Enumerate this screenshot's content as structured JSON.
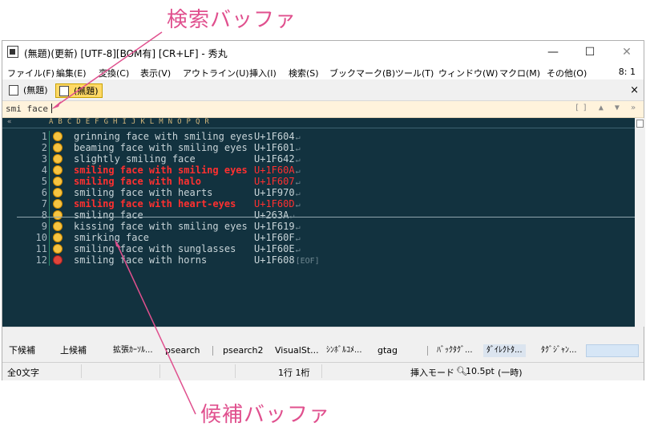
{
  "annotations": {
    "search_buffer": "検索バッファ",
    "candidate_buffer": "候補バッファ",
    "color": "#e0508e"
  },
  "window": {
    "title": "(無題)(更新) [UTF-8][BOM有] [CR+LF] - 秀丸",
    "minimize": "—",
    "maximize": "☐",
    "close": "✕"
  },
  "menu": {
    "items": [
      "ファイル(F)",
      "編集(E)",
      "変換(C)",
      "表示(V)",
      "アウトライン(U)",
      "挿入(I)",
      "検索(S)",
      "ブックマーク(B)",
      "ツール(T)",
      "ウィンドウ(W)",
      "マクロ(M)",
      "その他(O)"
    ],
    "position": "8: 1"
  },
  "tabs": [
    {
      "label": "(無題)",
      "active": false
    },
    {
      "label": "(無題)",
      "active": true
    }
  ],
  "tab_close": "×",
  "search": {
    "value": "smi face",
    "controls": "[] ▲ ▼ »"
  },
  "ruler": "A     B                          C     D     E     F     G     H     I     J     K     L     M     N     O     P     Q     R",
  "ruler_mark": "«",
  "lines": [
    {
      "num": "1",
      "name": "grinning face with smiling eyes",
      "code": "U+1F604",
      "hit": false,
      "emoji": "yellow"
    },
    {
      "num": "2",
      "name": "beaming face with smiling eyes",
      "code": "U+1F601",
      "hit": false,
      "emoji": "yellow"
    },
    {
      "num": "3",
      "name": "slightly smiling face",
      "code": "U+1F642",
      "hit": false,
      "emoji": "yellow"
    },
    {
      "num": "4",
      "name": "smiling face with smiling eyes",
      "code": "U+1F60A",
      "hit": true,
      "emoji": "yellow"
    },
    {
      "num": "5",
      "name": "smiling face with halo",
      "code": "U+1F607",
      "hit": true,
      "emoji": "yellow"
    },
    {
      "num": "6",
      "name": "smiling face with hearts",
      "code": "U+1F970",
      "hit": false,
      "emoji": "yellow"
    },
    {
      "num": "7",
      "name": "smiling face with heart-eyes",
      "code": "U+1F60D",
      "hit": true,
      "emoji": "yellow"
    },
    {
      "num": "8",
      "name": "smiling face",
      "code": "U+263A",
      "hit": false,
      "emoji": "yellow"
    },
    {
      "num": "9",
      "name": "kissing face with smiling eyes",
      "code": "U+1F619",
      "hit": false,
      "emoji": "yellow"
    },
    {
      "num": "10",
      "name": "smirking face",
      "code": "U+1F60F",
      "hit": false,
      "emoji": "yellow"
    },
    {
      "num": "11",
      "name": "smiling face with sunglasses",
      "code": "U+1F60E",
      "hit": false,
      "emoji": "yellow"
    },
    {
      "num": "12",
      "name": "smiling face with horns",
      "code": "U+1F608",
      "hit": false,
      "emoji": "red",
      "eof": "[EOF]"
    }
  ],
  "eol_mark": "↵",
  "funcbar": {
    "keys": [
      "下候補",
      "上候補",
      "拡張ｶｰｿﾙ...",
      "psearch",
      "psearch2",
      "VisualSt...",
      "ｼﾝﾎﾞﾙｺﾒ...",
      "gtag",
      "ﾊﾞｯｸﾀｸﾞ...",
      "ﾀﾞｲﾚｸﾄﾀ...",
      "ﾀｸﾞｼﾞｬﾝ..."
    ]
  },
  "status": {
    "chars": "全0文字",
    "position": "1行 1桁",
    "mode": "挿入モード",
    "zoom": "10.5pt",
    "extra": "(一時)"
  }
}
